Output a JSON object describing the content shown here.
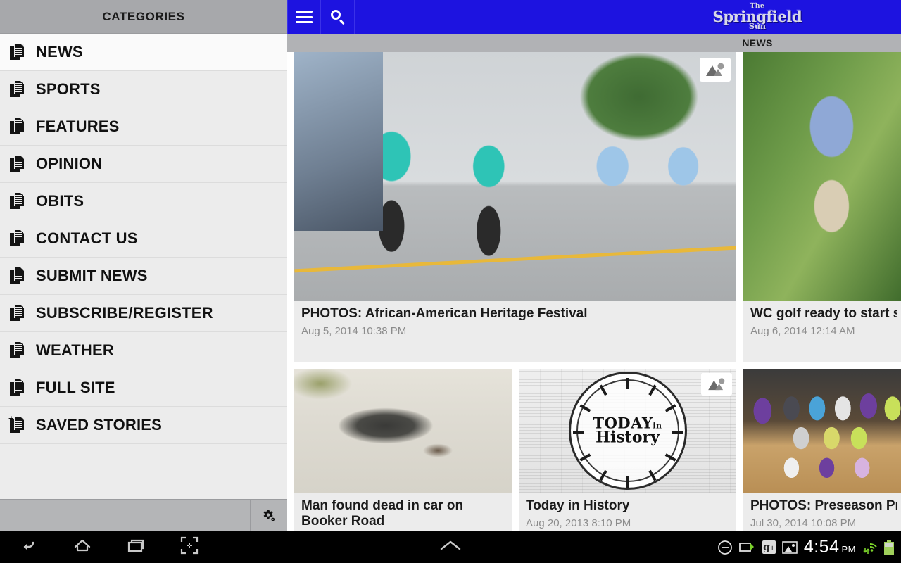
{
  "drawer": {
    "header_title": "CATEGORIES",
    "items": [
      {
        "label": "NEWS",
        "icon": "document-icon"
      },
      {
        "label": "SPORTS",
        "icon": "document-icon"
      },
      {
        "label": "FEATURES",
        "icon": "document-icon"
      },
      {
        "label": "OPINION",
        "icon": "document-icon"
      },
      {
        "label": "OBITS",
        "icon": "document-icon"
      },
      {
        "label": "CONTACT US",
        "icon": "document-icon"
      },
      {
        "label": "SUBMIT NEWS",
        "icon": "document-icon"
      },
      {
        "label": "SUBSCRIBE/REGISTER",
        "icon": "document-icon"
      },
      {
        "label": "WEATHER",
        "icon": "document-icon"
      },
      {
        "label": "FULL SITE",
        "icon": "document-icon"
      },
      {
        "label": "SAVED STORIES",
        "icon": "document-add-icon"
      }
    ],
    "footer": {
      "settings_icon": "gear-icon"
    }
  },
  "actionbar": {
    "menu_icon": "hamburger-menu-icon",
    "search_icon": "search-icon",
    "brand": {
      "line1": "The",
      "line2": "Springfield",
      "line3": "Sun"
    },
    "accent_color": "#1d13e0"
  },
  "tabbar": {
    "active_tab": "NEWS",
    "background_color": "#b1b2b5"
  },
  "articles": [
    {
      "title": "PHOTOS: African-American Heritage Festival",
      "date": "Aug 5, 2014 10:38 PM",
      "badge": "photo-gallery-icon",
      "image_alt": "parade-dancers-photo"
    },
    {
      "title": "WC golf ready to start se",
      "date": "Aug 6, 2014 12:14 AM",
      "badge": null,
      "image_alt": "golfer-photo"
    },
    {
      "title": "Man found dead in car on Booker Road",
      "date": "",
      "badge": null,
      "image_alt": "road-burn-mark-photo"
    },
    {
      "title": "Today in History",
      "date": "Aug 20, 2013 8:10 PM",
      "badge": "photo-gallery-icon",
      "image_alt": "today-in-history-clock-graphic",
      "graphic_text": {
        "line1": "TODAY",
        "line1_small": "in",
        "line2": "History"
      }
    },
    {
      "title": "PHOTOS: Preseason Pre",
      "date": "Jul 30, 2014 10:08 PM",
      "badge": null,
      "image_alt": "volleyball-team-photo"
    }
  ],
  "navbar": {
    "back_icon": "back-arrow-icon",
    "home_icon": "home-icon",
    "recents_icon": "recent-apps-icon",
    "screenshot_icon": "screenshot-icon",
    "expand_icon": "chevron-up-icon"
  },
  "statusbar": {
    "dnd_icon": "do-not-disturb-icon",
    "usb_icon": "usb-debugging-icon",
    "gplus_icon": "google-plus-icon",
    "screenshot_saved_icon": "image-icon",
    "time": "4:54",
    "ampm": "PM",
    "wifi_icon": "wifi-icon",
    "battery_icon": "battery-icon"
  }
}
